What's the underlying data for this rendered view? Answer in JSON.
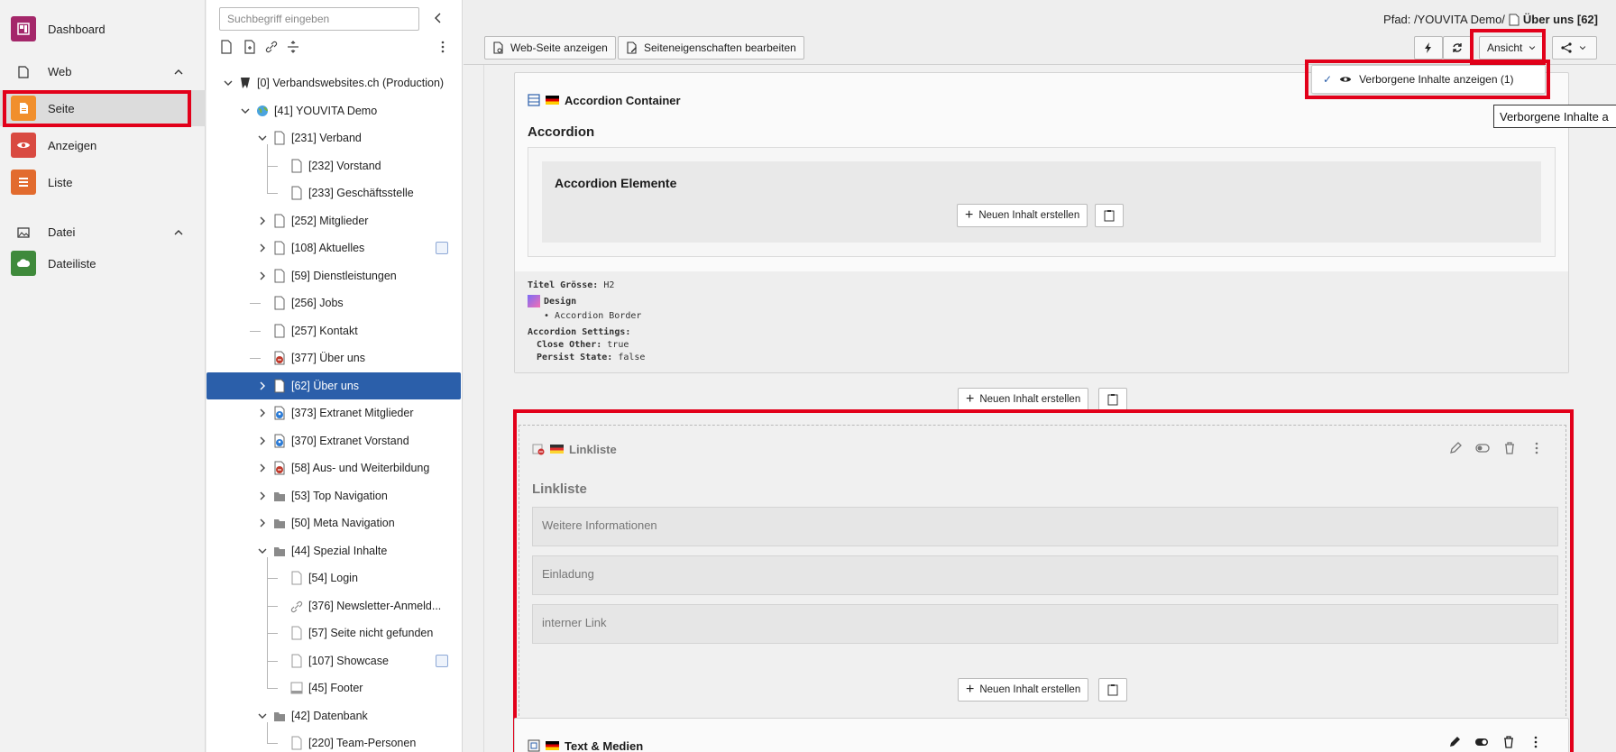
{
  "module_menu": {
    "dashboard": "Dashboard",
    "web_group": "Web",
    "seite": "Seite",
    "anzeigen": "Anzeigen",
    "liste": "Liste",
    "datei_group": "Datei",
    "dateiliste": "Dateiliste"
  },
  "tree": {
    "search_placeholder": "Suchbegriff eingeben",
    "items": [
      {
        "label": "[0] Verbandswebsites.ch (Production)"
      },
      {
        "label": "[41] YOUVITA Demo"
      },
      {
        "label": "[231] Verband"
      },
      {
        "label": "[232] Vorstand"
      },
      {
        "label": "[233] Geschäftsstelle"
      },
      {
        "label": "[252] Mitglieder"
      },
      {
        "label": "[108] Aktuelles"
      },
      {
        "label": "[59] Dienstleistungen"
      },
      {
        "label": "[256] Jobs"
      },
      {
        "label": "[257] Kontakt"
      },
      {
        "label": "[377] Über uns"
      },
      {
        "label": "[62] Über uns"
      },
      {
        "label": "[373] Extranet Mitglieder"
      },
      {
        "label": "[370] Extranet Vorstand"
      },
      {
        "label": "[58] Aus- und Weiterbildung"
      },
      {
        "label": "[53] Top Navigation"
      },
      {
        "label": "[50] Meta Navigation"
      },
      {
        "label": "[44] Spezial Inhalte"
      },
      {
        "label": "[54] Login"
      },
      {
        "label": "[376] Newsletter-Anmeld..."
      },
      {
        "label": "[57] Seite nicht gefunden"
      },
      {
        "label": "[107] Showcase"
      },
      {
        "label": "[45] Footer"
      },
      {
        "label": "[42] Datenbank"
      },
      {
        "label": "[220] Team-Personen"
      }
    ]
  },
  "header": {
    "path_prefix": "Pfad: /YOUVITA Demo/",
    "path_page": "Über uns [62]",
    "view_web_page": "Web-Seite anzeigen",
    "edit_page_props": "Seiteneigenschaften bearbeiten",
    "view_menu": "Ansicht"
  },
  "dropdown": {
    "show_hidden": "Verborgene Inhalte anzeigen (1)",
    "tooltip": "Verborgene Inhalte a"
  },
  "content": {
    "accordion": {
      "type": "Accordion Container",
      "title": "Accordion",
      "inner_title": "Accordion Elemente",
      "new_content": "Neuen Inhalt erstellen",
      "meta_title_size_label": "Titel Grösse:",
      "meta_title_size_value": "H2",
      "meta_design": "Design",
      "meta_design_item": "Accordion Border",
      "meta_settings": "Accordion Settings:",
      "meta_close_other_label": "Close Other:",
      "meta_close_other_value": "true",
      "meta_persist_label": "Persist State:",
      "meta_persist_value": "false"
    },
    "new_content_1": "Neuen Inhalt erstellen",
    "linklist": {
      "type": "Linkliste",
      "title": "Linkliste",
      "links": [
        "Weitere Informationen",
        "Einladung",
        "interner Link"
      ]
    },
    "new_content_2": "Neuen Inhalt erstellen",
    "textmedia": {
      "type": "Text & Medien"
    }
  },
  "colors": {
    "highlight_red": "#e2001a",
    "tree_selected": "#2b5faa"
  }
}
